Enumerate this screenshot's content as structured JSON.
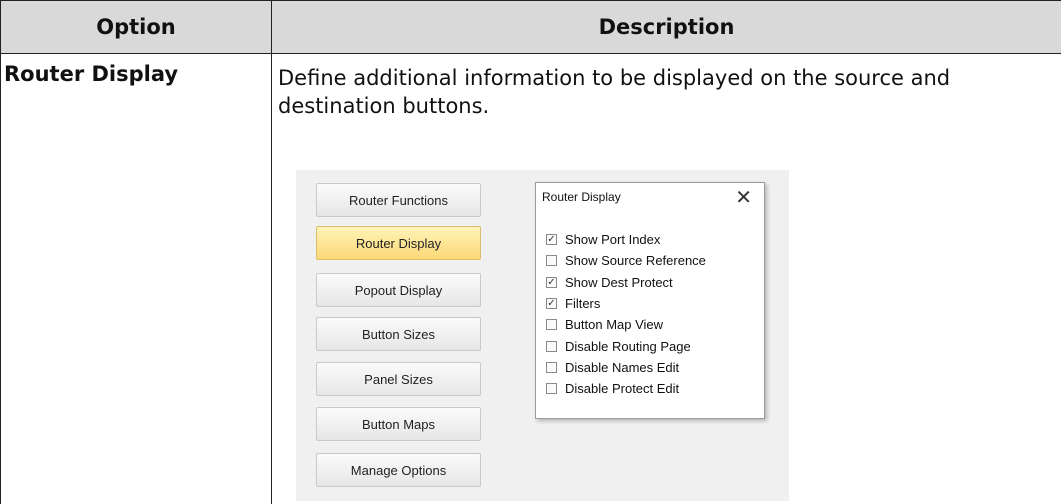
{
  "table": {
    "header_option": "Option",
    "header_description": "Description",
    "row": {
      "option": "Router Display",
      "description": "Define additional information to be displayed on the source and destination buttons."
    }
  },
  "screenshot": {
    "buttons": [
      {
        "label": "Router Functions",
        "active": false
      },
      {
        "label": "Router Display",
        "active": true
      },
      {
        "label": "Popout Display",
        "active": false
      },
      {
        "label": "Button Sizes",
        "active": false
      },
      {
        "label": "Panel Sizes",
        "active": false
      },
      {
        "label": "Button Maps",
        "active": false
      },
      {
        "label": "Manage Options",
        "active": false
      }
    ],
    "popup": {
      "title": "Router Display",
      "close_glyph": "✕",
      "options": [
        {
          "label": "Show Port Index",
          "checked": true
        },
        {
          "label": "Show Source Reference",
          "checked": false
        },
        {
          "label": "Show Dest Protect",
          "checked": true
        },
        {
          "label": "Filters",
          "checked": true
        },
        {
          "label": "Button Map View",
          "checked": false
        },
        {
          "label": "Disable Routing Page",
          "checked": false
        },
        {
          "label": "Disable Names Edit",
          "checked": false
        },
        {
          "label": "Disable Protect Edit",
          "checked": false
        }
      ]
    },
    "colors": {
      "active_button": "#fdd877"
    }
  }
}
